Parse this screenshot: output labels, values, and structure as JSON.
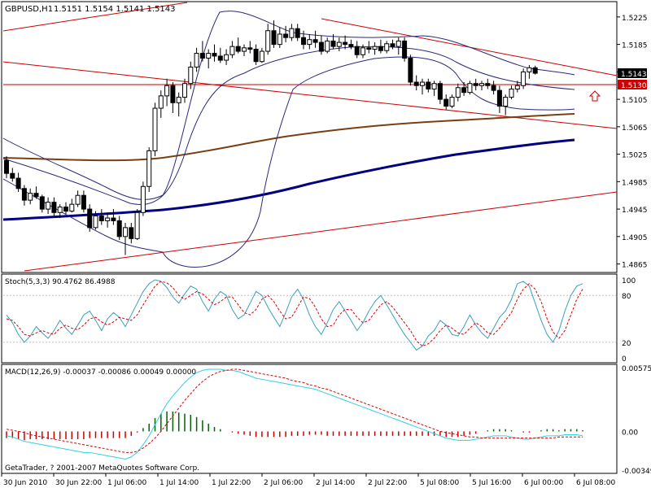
{
  "header": {
    "symbol_text": "GBPUSD,H1",
    "ohlc_text": "1.5151 1.5154 1.5141 1.5143"
  },
  "price_panel": {
    "ticks": [
      "1.5225",
      "1.5185",
      "1.5145",
      "1.5105",
      "1.5065",
      "1.5025",
      "1.4985",
      "1.4945",
      "1.4905",
      "1.4865"
    ],
    "current_price_label": "1.5143",
    "hline_label": "1.5130"
  },
  "stoch_panel": {
    "title": "Stoch(5,3,3) 90.4762 86.4988",
    "ticks": [
      "100",
      "80",
      "20",
      "0"
    ]
  },
  "macd_panel": {
    "title": "MACD(12,26,9) -0.00037 -0.00086 0.00049 0.00000",
    "ticks": [
      "0.00575",
      "0.00",
      "-0.00349"
    ]
  },
  "time_axis": [
    "30 Jun 2010",
    "30 Jun 22:00",
    "1 Jul 06:00",
    "1 Jul 14:00",
    "1 Jul 22:00",
    "2 Jul 06:00",
    "2 Jul 14:00",
    "2 Jul 22:00",
    "5 Jul 08:00",
    "5 Jul 16:00",
    "6 Jul 00:00",
    "6 Jul 08:00"
  ],
  "copyright": "GetaTrader, ? 2001-2007 MetaQuotes Software Corp.",
  "colors": {
    "bull": "#ffffff",
    "bear": "#000000",
    "trendline": "#cc0000",
    "ma_brown": "#7a3f10",
    "ma_navy": "#000080",
    "bollinger": "#2a2a7a",
    "stoch_main": "#3aa0c0",
    "stoch_signal": "#dd0000",
    "macd_main": "#33d0e0",
    "macd_signal": "#dd0000",
    "hist_pos": "#006400",
    "hist_neg": "#cc0000"
  },
  "chart_data": [
    {
      "type": "candlestick",
      "name": "GBPUSD,H1",
      "ylim": [
        1.4855,
        1.5245
      ],
      "ohlc": [
        [
          1.5016,
          1.5022,
          1.499,
          1.4997
        ],
        [
          1.4997,
          1.5005,
          1.4985,
          1.499
        ],
        [
          1.499,
          1.4998,
          1.497,
          1.4975
        ],
        [
          1.4975,
          1.498,
          1.495,
          1.4958
        ],
        [
          1.4958,
          1.4975,
          1.4952,
          1.4968
        ],
        [
          1.4968,
          1.4978,
          1.496,
          1.4963
        ],
        [
          1.4963,
          1.4966,
          1.494,
          1.4945
        ],
        [
          1.4945,
          1.4962,
          1.4938,
          1.4955
        ],
        [
          1.4955,
          1.4962,
          1.4935,
          1.494
        ],
        [
          1.494,
          1.4952,
          1.4932,
          1.4948
        ],
        [
          1.4948,
          1.4955,
          1.4938,
          1.4942
        ],
        [
          1.4942,
          1.496,
          1.494,
          1.4952
        ],
        [
          1.4952,
          1.4972,
          1.4948,
          1.4965
        ],
        [
          1.4965,
          1.4972,
          1.494,
          1.4945
        ],
        [
          1.4945,
          1.4952,
          1.4912,
          1.4918
        ],
        [
          1.4918,
          1.4942,
          1.4915,
          1.4935
        ],
        [
          1.4935,
          1.4945,
          1.4922,
          1.4928
        ],
        [
          1.4928,
          1.494,
          1.4918,
          1.4932
        ],
        [
          1.4932,
          1.4945,
          1.4922,
          1.4928
        ],
        [
          1.4928,
          1.4935,
          1.49,
          1.4905
        ],
        [
          1.4905,
          1.4925,
          1.4878,
          1.4918
        ],
        [
          1.4918,
          1.4925,
          1.4895,
          1.4902
        ],
        [
          1.4902,
          1.4945,
          1.49,
          1.494
        ],
        [
          1.494,
          1.4985,
          1.4935,
          1.4978
        ],
        [
          1.4978,
          1.5035,
          1.497,
          1.503
        ],
        [
          1.503,
          1.51,
          1.5022,
          1.5092
        ],
        [
          1.5092,
          1.5118,
          1.5078,
          1.511
        ],
        [
          1.511,
          1.5135,
          1.5095,
          1.5125
        ],
        [
          1.5125,
          1.513,
          1.5085,
          1.51
        ],
        [
          1.51,
          1.5115,
          1.508,
          1.5108
        ],
        [
          1.5108,
          1.5135,
          1.51,
          1.5128
        ],
        [
          1.5128,
          1.516,
          1.512,
          1.5152
        ],
        [
          1.5152,
          1.518,
          1.5145,
          1.5172
        ],
        [
          1.5172,
          1.519,
          1.516,
          1.5165
        ],
        [
          1.5165,
          1.5178,
          1.515,
          1.5172
        ],
        [
          1.5172,
          1.5185,
          1.516,
          1.5168
        ],
        [
          1.5168,
          1.518,
          1.5158,
          1.5162
        ],
        [
          1.5162,
          1.5178,
          1.5155,
          1.517
        ],
        [
          1.517,
          1.519,
          1.5165,
          1.5182
        ],
        [
          1.5182,
          1.5195,
          1.5172,
          1.5175
        ],
        [
          1.5175,
          1.5185,
          1.5168,
          1.518
        ],
        [
          1.518,
          1.519,
          1.5172,
          1.5178
        ],
        [
          1.5178,
          1.5185,
          1.5155,
          1.516
        ],
        [
          1.516,
          1.518,
          1.5158,
          1.5175
        ],
        [
          1.5175,
          1.5215,
          1.517,
          1.5205
        ],
        [
          1.5205,
          1.522,
          1.518,
          1.5185
        ],
        [
          1.5185,
          1.521,
          1.518,
          1.52
        ],
        [
          1.52,
          1.5212,
          1.5188,
          1.5195
        ],
        [
          1.5195,
          1.5215,
          1.519,
          1.5208
        ],
        [
          1.5208,
          1.5215,
          1.519,
          1.5195
        ],
        [
          1.5195,
          1.5205,
          1.5178,
          1.5185
        ],
        [
          1.5185,
          1.52,
          1.5178,
          1.5192
        ],
        [
          1.5192,
          1.5205,
          1.518,
          1.5188
        ],
        [
          1.5188,
          1.5198,
          1.517,
          1.5175
        ],
        [
          1.5175,
          1.5195,
          1.5172,
          1.519
        ],
        [
          1.519,
          1.52,
          1.5178,
          1.5182
        ],
        [
          1.5182,
          1.5195,
          1.5175,
          1.5188
        ],
        [
          1.5188,
          1.5198,
          1.5178,
          1.5185
        ],
        [
          1.5185,
          1.5192,
          1.5178,
          1.5182
        ],
        [
          1.5182,
          1.519,
          1.5165,
          1.517
        ],
        [
          1.517,
          1.5185,
          1.5165,
          1.518
        ],
        [
          1.518,
          1.519,
          1.5172,
          1.5178
        ],
        [
          1.5178,
          1.5188,
          1.517,
          1.5182
        ],
        [
          1.5182,
          1.5192,
          1.5172,
          1.5176
        ],
        [
          1.5176,
          1.519,
          1.5172,
          1.5186
        ],
        [
          1.5186,
          1.5192,
          1.5178,
          1.5182
        ],
        [
          1.5182,
          1.5195,
          1.517,
          1.519
        ],
        [
          1.519,
          1.5195,
          1.516,
          1.5165
        ],
        [
          1.5165,
          1.517,
          1.5125,
          1.513
        ],
        [
          1.513,
          1.514,
          1.5118,
          1.5125
        ],
        [
          1.5125,
          1.5135,
          1.5112,
          1.513
        ],
        [
          1.513,
          1.5135,
          1.5115,
          1.512
        ],
        [
          1.512,
          1.5132,
          1.511,
          1.5128
        ],
        [
          1.5128,
          1.5132,
          1.5098,
          1.5105
        ],
        [
          1.5105,
          1.5112,
          1.509,
          1.5095
        ],
        [
          1.5095,
          1.5112,
          1.5092,
          1.5108
        ],
        [
          1.5108,
          1.5128,
          1.5102,
          1.5122
        ],
        [
          1.5122,
          1.513,
          1.511,
          1.5115
        ],
        [
          1.5115,
          1.5132,
          1.5112,
          1.5128
        ],
        [
          1.5128,
          1.5135,
          1.5118,
          1.5125
        ],
        [
          1.5125,
          1.5132,
          1.5118,
          1.5128
        ],
        [
          1.5128,
          1.5135,
          1.512,
          1.5125
        ],
        [
          1.5125,
          1.5132,
          1.5112,
          1.5118
        ],
        [
          1.5118,
          1.5125,
          1.5085,
          1.5095
        ],
        [
          1.5095,
          1.5112,
          1.5082,
          1.5108
        ],
        [
          1.5108,
          1.5125,
          1.5105,
          1.512
        ],
        [
          1.512,
          1.5132,
          1.5115,
          1.5125
        ],
        [
          1.5125,
          1.515,
          1.512,
          1.5145
        ],
        [
          1.5145,
          1.5155,
          1.5135,
          1.5151
        ],
        [
          1.5151,
          1.5154,
          1.5141,
          1.5143
        ]
      ]
    },
    {
      "type": "line",
      "name": "Stoch(5,3,3)",
      "ylim": [
        0,
        100
      ],
      "series": [
        {
          "name": "main",
          "values": [
            55,
            45,
            30,
            20,
            28,
            40,
            32,
            25,
            35,
            48,
            38,
            30,
            42,
            55,
            60,
            48,
            35,
            50,
            58,
            52,
            40,
            55,
            70,
            85,
            95,
            100,
            98,
            90,
            78,
            70,
            82,
            92,
            88,
            72,
            60,
            75,
            85,
            80,
            62,
            50,
            55,
            70,
            85,
            80,
            65,
            52,
            40,
            58,
            78,
            88,
            75,
            55,
            40,
            30,
            45,
            62,
            72,
            60,
            48,
            35,
            45,
            60,
            72,
            80,
            68,
            55,
            42,
            30,
            20,
            10,
            15,
            28,
            35,
            48,
            42,
            30,
            28,
            40,
            55,
            42,
            32,
            25,
            38,
            52,
            60,
            75,
            95,
            98,
            92,
            70,
            48,
            30,
            20,
            35,
            60,
            80,
            92,
            95
          ]
        },
        {
          "name": "signal",
          "values": [
            50,
            48,
            40,
            30,
            28,
            32,
            35,
            32,
            30,
            38,
            42,
            38,
            36,
            42,
            50,
            52,
            46,
            42,
            46,
            52,
            50,
            48,
            55,
            68,
            80,
            92,
            98,
            96,
            90,
            80,
            75,
            80,
            85,
            82,
            75,
            68,
            72,
            78,
            78,
            68,
            58,
            55,
            62,
            75,
            80,
            72,
            60,
            50,
            52,
            65,
            78,
            76,
            65,
            50,
            40,
            42,
            55,
            62,
            62,
            52,
            45,
            48,
            58,
            68,
            72,
            65,
            55,
            45,
            35,
            22,
            15,
            18,
            25,
            35,
            42,
            38,
            32,
            30,
            38,
            45,
            40,
            32,
            30,
            38,
            48,
            58,
            75,
            88,
            95,
            88,
            72,
            50,
            33,
            25,
            35,
            55,
            75,
            88
          ]
        }
      ]
    },
    {
      "type": "bar",
      "name": "MACD(12,26,9)",
      "ylim": [
        -0.00349,
        0.00575
      ],
      "series": [
        {
          "name": "macd",
          "values": [
            -0.0004,
            -0.0005,
            -0.0007,
            -0.0009,
            -0.001,
            -0.0011,
            -0.0012,
            -0.0013,
            -0.0014,
            -0.0015,
            -0.0016,
            -0.0017,
            -0.0018,
            -0.0019,
            -0.0019,
            -0.002,
            -0.0021,
            -0.0022,
            -0.0023,
            -0.0024,
            -0.0025,
            -0.0023,
            -0.0019,
            -0.0012,
            -0.0004,
            0.0006,
            0.0016,
            0.0025,
            0.0032,
            0.0038,
            0.0044,
            0.0049,
            0.0053,
            0.0055,
            0.0056,
            0.0056,
            0.0056,
            0.0055,
            0.0055,
            0.0054,
            0.0052,
            0.005,
            0.0048,
            0.0047,
            0.0046,
            0.0045,
            0.0044,
            0.0043,
            0.0042,
            0.0041,
            0.004,
            0.0039,
            0.0038,
            0.0036,
            0.0034,
            0.0032,
            0.003,
            0.0028,
            0.0026,
            0.0024,
            0.0022,
            0.002,
            0.0018,
            0.0016,
            0.0014,
            0.0012,
            0.001,
            0.0008,
            0.0006,
            0.0004,
            0.0002,
            0.0,
            -0.0002,
            -0.0004,
            -0.0006,
            -0.0007,
            -0.0008,
            -0.0008,
            -0.0008,
            -0.0007,
            -0.0006,
            -0.0005,
            -0.0004,
            -0.0004,
            -0.0004,
            -0.0005,
            -0.0006,
            -0.0007,
            -0.0007,
            -0.0006,
            -0.0005,
            -0.0004,
            -0.0004,
            -0.0004,
            -0.0003,
            -0.0003,
            -0.0003,
            -0.0004
          ]
        },
        {
          "name": "signal",
          "values": [
            0.0002,
            0.0001,
            0.0,
            -0.0001,
            -0.0003,
            -0.0004,
            -0.0005,
            -0.0006,
            -0.0007,
            -0.0008,
            -0.0009,
            -0.001,
            -0.0011,
            -0.0012,
            -0.0013,
            -0.0014,
            -0.0015,
            -0.0016,
            -0.0017,
            -0.0018,
            -0.0019,
            -0.0019,
            -0.0018,
            -0.0015,
            -0.0011,
            -0.0006,
            0.0,
            0.0007,
            0.0014,
            0.0021,
            0.0028,
            0.0034,
            0.004,
            0.0045,
            0.0049,
            0.0052,
            0.0054,
            0.0055,
            0.0056,
            0.0056,
            0.0055,
            0.0054,
            0.0053,
            0.0052,
            0.0051,
            0.005,
            0.0049,
            0.0048,
            0.0046,
            0.0045,
            0.0044,
            0.0042,
            0.0041,
            0.0039,
            0.0038,
            0.0036,
            0.0034,
            0.0032,
            0.003,
            0.0028,
            0.0026,
            0.0024,
            0.0022,
            0.002,
            0.0018,
            0.0016,
            0.0014,
            0.0012,
            0.001,
            0.0008,
            0.0006,
            0.0004,
            0.0002,
            0.0,
            -0.0001,
            -0.0002,
            -0.0003,
            -0.0004,
            -0.0005,
            -0.0005,
            -0.0006,
            -0.0006,
            -0.0006,
            -0.0006,
            -0.0006,
            -0.0006,
            -0.0006,
            -0.0006,
            -0.0006,
            -0.0006,
            -0.0006,
            -0.0006,
            -0.0006,
            -0.0005,
            -0.0005,
            -0.0005,
            -0.0005,
            -0.0005
          ]
        }
      ]
    }
  ]
}
